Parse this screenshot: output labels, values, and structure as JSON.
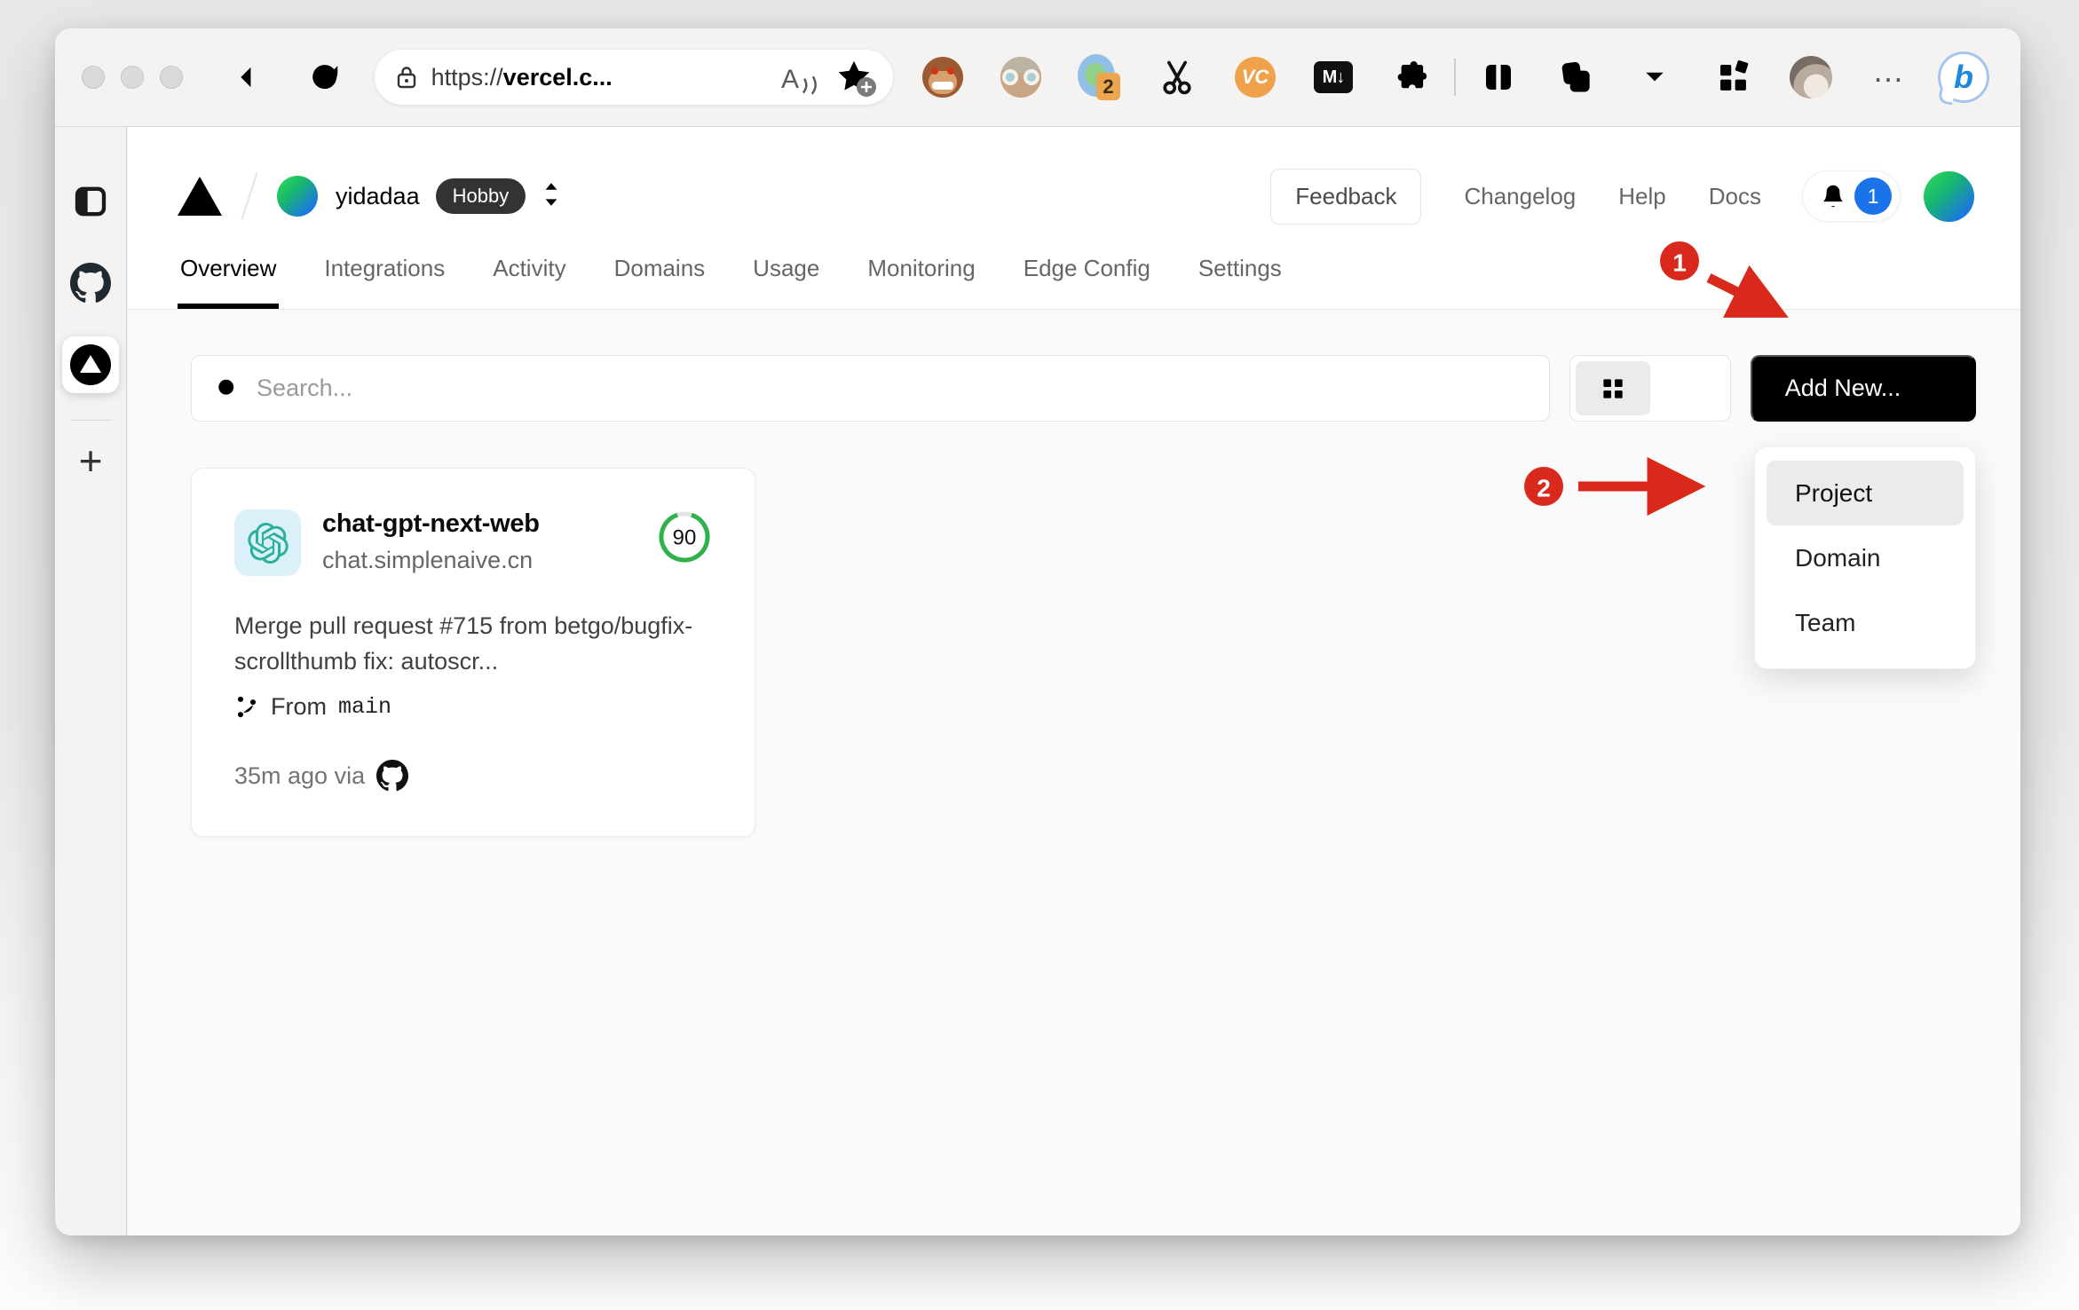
{
  "browser": {
    "url_prefix": "https://",
    "url_host": "vercel.c...",
    "ext_badge": "2",
    "vc_label": "VC",
    "md_label": "M↓",
    "readaloud_label": "A",
    "dots_label": "…",
    "bing_label": "b"
  },
  "sidebar": {
    "new_tab": "+"
  },
  "site_header": {
    "team": "yidadaa",
    "plan": "Hobby",
    "feedback": "Feedback",
    "nav": [
      {
        "label": "Changelog"
      },
      {
        "label": "Help"
      },
      {
        "label": "Docs"
      }
    ],
    "notifications": "1"
  },
  "tabs": [
    {
      "label": "Overview"
    },
    {
      "label": "Integrations"
    },
    {
      "label": "Activity"
    },
    {
      "label": "Domains"
    },
    {
      "label": "Usage"
    },
    {
      "label": "Monitoring"
    },
    {
      "label": "Edge Config"
    },
    {
      "label": "Settings"
    }
  ],
  "controls": {
    "search_placeholder": "Search...",
    "add_new": "Add New..."
  },
  "dropdown": {
    "items": [
      {
        "label": "Project"
      },
      {
        "label": "Domain"
      },
      {
        "label": "Team"
      }
    ]
  },
  "annotations": {
    "step1": "1",
    "step2": "2"
  },
  "card": {
    "name": "chat-gpt-next-web",
    "domain": "chat.simplenaive.cn",
    "score": "90",
    "commit": "Merge pull request #715 from betgo/bugfix-scrollthumb fix: autoscr...",
    "from_label": "From",
    "branch": "main",
    "time": "35m ago via"
  },
  "colors": {
    "annotation_red": "#d9291c",
    "badge_blue": "#1a73e8",
    "score_green": "#2fb14c",
    "add_new_bg": "#000000",
    "hobby_bg": "#333333"
  }
}
